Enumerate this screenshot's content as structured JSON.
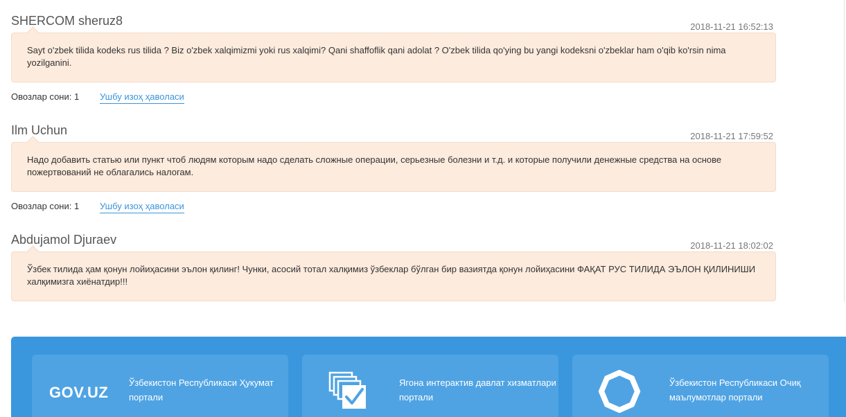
{
  "comments": [
    {
      "author": "SHERCOM sheruz8",
      "timestamp": "2018-11-21 16:52:13",
      "text": "Sayt o'zbek tilida kodeks rus tilida ? Biz o'zbek xalqimizmi yoki rus xalqimi? Qani shaffoflik qani adolat ? O'zbek tilida qo'ying bu yangi kodeksni o'zbeklar ham o'qib ko'rsin nima yozilganini.",
      "replies": "Овозлар сони: 1",
      "link": "Ушбу изоҳ ҳаволаси"
    },
    {
      "author": "Ilm Uchun",
      "timestamp": "2018-11-21 17:59:52",
      "text": "Надо добавить статью или пункт чтоб людям которым надо сделать сложные операции, серьезные болезни и т.д. и которые получили денежные средства на основе пожертвований не облагались налогам.",
      "replies": "Овозлар сони: 1",
      "link": "Ушбу изоҳ ҳаволаси"
    },
    {
      "author": "Abdujamol Djuraev",
      "timestamp": "2018-11-21 18:02:02",
      "text": "Ўзбек тилида ҳам қонун лойиҳасини эълон қилинг! Чунки, асосий тотал халқимиз ўзбеклар бўлган бир вазиятда қонун лойиҳасини ФАҚАТ РУС ТИЛИДА ЭЪЛОН ҚИЛИНИШИ халқимизга хиёнатдир!!!"
    }
  ],
  "footer": {
    "cards": [
      {
        "logo_text": "GOV.UZ",
        "text": "Ўзбекистон Республикаси Ҳукумат портали"
      },
      {
        "icon": "interactive-services-icon",
        "text": "Ягона интерактив давлат хизматлари портали"
      },
      {
        "icon": "open-data-icon",
        "text": "Ўзбекистон Республикаси Очиқ маълумотлар портали"
      }
    ]
  },
  "colors": {
    "bubble": "#fdebdd",
    "link": "#3b94d9",
    "footer": "#3a97dd",
    "card": "#4fa3e3"
  }
}
